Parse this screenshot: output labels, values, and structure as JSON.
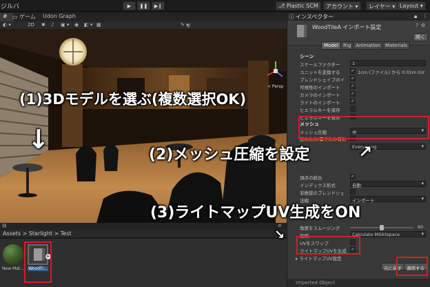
{
  "toolbar": {
    "left_label": "ジルバ",
    "plastic": "Plastic SCM",
    "account": "アカウント ▾",
    "layers": "レイヤー ▾",
    "layout": "Layout ▾"
  },
  "scene_tabs": [
    "ゲーム",
    "Udon Graph"
  ],
  "scene_toolbar": {
    "mode": "2D",
    "gizmos": "ギズモ",
    "persp": "< Persp"
  },
  "annotations": {
    "step1": "(1)3Dモデルを選ぶ(複数選択OK)",
    "step2": "(2)メッシュ圧縮を設定",
    "step3": "(3)ライトマップUV生成をON"
  },
  "project": {
    "breadcrumb": "Assets > Starlight > Test",
    "assets": [
      {
        "label": "New Mat..."
      },
      {
        "label": "WoodTi..."
      }
    ]
  },
  "inspector": {
    "tab": "インスペクター",
    "title": "WoodTileA インポート設定",
    "open_button": "開く",
    "subtabs": [
      "Model",
      "Rig",
      "Animation",
      "Materials"
    ],
    "scene_header": "シーン",
    "rows": [
      {
        "label": "スケールファクター",
        "value": "1"
      },
      {
        "label": "ユニットを変換する",
        "value": "1cm (ファイル) から 0.01m (Ur"
      },
      {
        "label": "ブレンドシェイプのイ",
        "value": ""
      },
      {
        "label": "可視性のインポート",
        "value": ""
      },
      {
        "label": "カメラのインポート",
        "value": ""
      },
      {
        "label": "ライトのインポート",
        "value": ""
      },
      {
        "label": "ヒエラルキーを保存",
        "value": ""
      },
      {
        "label": "ヒエラルキーを表示",
        "value": ""
      }
    ],
    "mesh_header": "メッシュ",
    "mesh_compression_label": "メッシュ圧縮",
    "mesh_compression_value": "中",
    "readwrite_label": "読み込み/書き込み有効",
    "lod_value": "Everything",
    "vertex_weld": "頂点の統合",
    "index_format_label": "インデックス形式",
    "index_format_value": "自動",
    "legacy_blend": "非推奨のブレンドシェ",
    "normals_label": "法線",
    "normals_value": "インポート",
    "smoothing_label": "角度をスムージング",
    "smoothing_value": "60",
    "smoothing_level": 0.5,
    "tangents_label": "接線",
    "tangents_value": "Calculate Mikktspace",
    "swap_uv": "UVをスワップ",
    "lightmap_uv": "ライトマップUVを生成",
    "lightmap_settings": "ライトマップUV設定",
    "revert_button": "元に戻す",
    "apply_button": "適用する",
    "footer": "Imported Object"
  }
}
